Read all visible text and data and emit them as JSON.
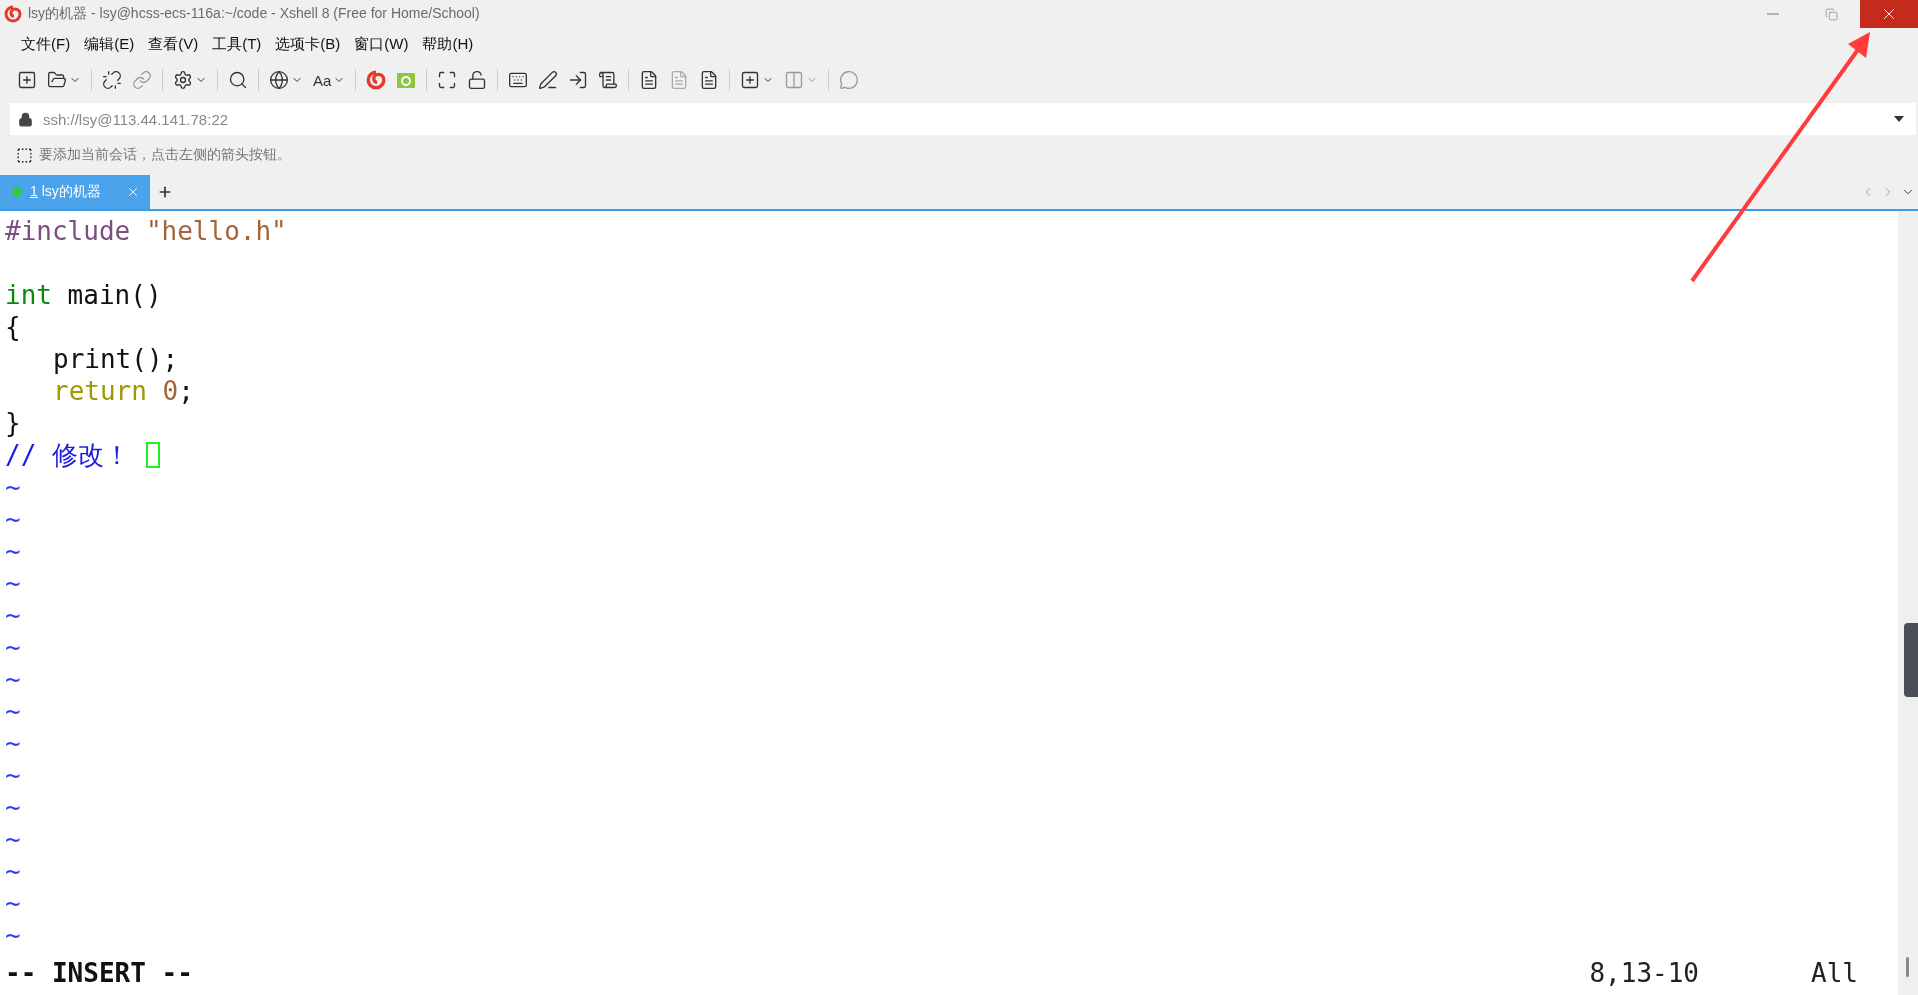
{
  "window": {
    "title": "lsy的机器 - lsy@hcss-ecs-116a:~/code - Xshell 8 (Free for Home/School)"
  },
  "menu": [
    "文件(F)",
    "编辑(E)",
    "查看(V)",
    "工具(T)",
    "选项卡(B)",
    "窗口(W)",
    "帮助(H)"
  ],
  "toolbar": {
    "font_button": "Aa"
  },
  "address_bar": {
    "value": "ssh://lsy@113.44.141.78:22"
  },
  "hint": "要添加当前会话，点击左侧的箭头按钮。",
  "tabs": [
    {
      "number": "1",
      "label": "lsy的机器",
      "selected": true
    }
  ],
  "terminal": {
    "lines": [
      {
        "segments": [
          {
            "text": "#include ",
            "kind": "preproc"
          },
          {
            "text": "\"hello.h\"",
            "kind": "string"
          }
        ],
        "blank_after": true
      },
      {
        "segments": [
          {
            "text": "int",
            "kind": "type"
          },
          {
            "text": " main()",
            "kind": "plain"
          }
        ]
      },
      {
        "segments": [
          {
            "text": "{",
            "kind": "plain"
          }
        ]
      },
      {
        "indented": true,
        "segments": [
          {
            "text": "print();",
            "kind": "plain"
          }
        ]
      },
      {
        "indented": true,
        "segments": [
          {
            "text": "return ",
            "kind": "statement"
          },
          {
            "text": "0",
            "kind": "number"
          },
          {
            "text": ";",
            "kind": "plain"
          }
        ]
      },
      {
        "segments": [
          {
            "text": "}",
            "kind": "plain"
          }
        ]
      },
      {
        "segments": [
          {
            "text": "// 修改！",
            "kind": "comment"
          }
        ],
        "cursor": true
      },
      {
        "segments": [
          {
            "text": "~",
            "kind": "filler"
          }
        ]
      },
      {
        "segments": [
          {
            "text": "~",
            "kind": "filler"
          }
        ]
      },
      {
        "segments": [
          {
            "text": "~",
            "kind": "filler"
          }
        ]
      },
      {
        "segments": [
          {
            "text": "~",
            "kind": "filler"
          }
        ]
      },
      {
        "segments": [
          {
            "text": "~",
            "kind": "filler"
          }
        ]
      },
      {
        "segments": [
          {
            "text": "~",
            "kind": "filler"
          }
        ]
      },
      {
        "segments": [
          {
            "text": "~",
            "kind": "filler"
          }
        ]
      },
      {
        "segments": [
          {
            "text": "~",
            "kind": "filler"
          }
        ]
      },
      {
        "segments": [
          {
            "text": "~",
            "kind": "filler"
          }
        ]
      },
      {
        "segments": [
          {
            "text": "~",
            "kind": "filler"
          }
        ]
      },
      {
        "segments": [
          {
            "text": "~",
            "kind": "filler"
          }
        ]
      },
      {
        "segments": [
          {
            "text": "~",
            "kind": "filler"
          }
        ]
      },
      {
        "segments": [
          {
            "text": "~",
            "kind": "filler"
          }
        ]
      },
      {
        "segments": [
          {
            "text": "~",
            "kind": "filler"
          }
        ]
      },
      {
        "segments": [
          {
            "text": "~",
            "kind": "filler"
          }
        ]
      }
    ],
    "status": {
      "mode": "-- INSERT --",
      "position": "8,13-10",
      "scroll": "All"
    }
  }
}
